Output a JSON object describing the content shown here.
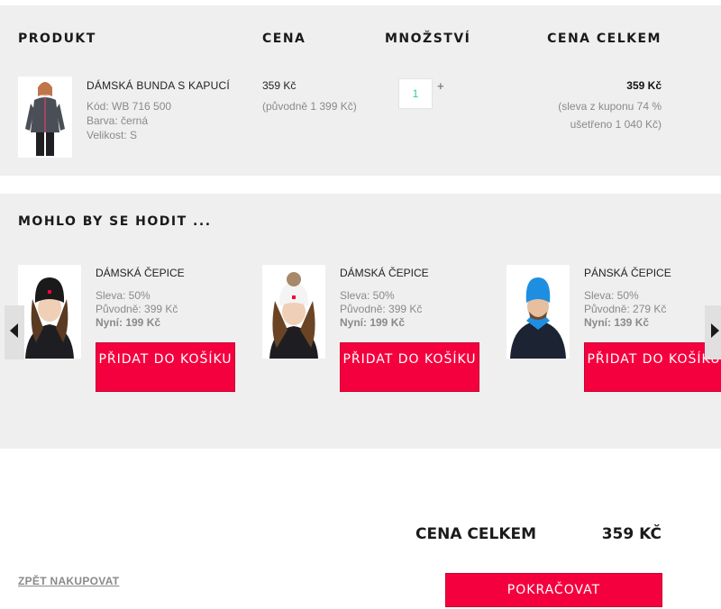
{
  "cart": {
    "headers": {
      "product": "PRODUKT",
      "price": "CENA",
      "quantity": "MNOŽSTVÍ",
      "total": "CENA CELKEM"
    },
    "item": {
      "name": "DÁMSKÁ BUNDA S KAPUCÍ",
      "code": "Kód: WB 716 500",
      "color": "Barva: černá",
      "size": "Velikost: S",
      "price_now": "359 Kč",
      "price_original": "(původně 1 399 Kč)",
      "quantity": "1",
      "quantity_plus": "+",
      "total": "359 Kč",
      "total_note": "(sleva z kuponu 74 % ušetřeno 1 040 Kč)"
    }
  },
  "recommendations": {
    "title": "MOHLO BY SE HODIT ...",
    "items": [
      {
        "name": "DÁMSKÁ ČEPICE",
        "discount": "Sleva: 50%",
        "original": "Původně: 399 Kč",
        "now": "Nyní: 199 Kč",
        "button": "PŘIDAT DO KOŠÍKU",
        "hat_color": "#1a1a1a"
      },
      {
        "name": "DÁMSKÁ ČEPICE",
        "discount": "Sleva: 50%",
        "original": "Původně: 399 Kč",
        "now": "Nyní: 199 Kč",
        "button": "PŘIDAT DO KOŠÍKU",
        "hat_color": "#f4f4f4"
      },
      {
        "name": "PÁNSKÁ ČEPICE",
        "discount": "Sleva: 50%",
        "original": "Původně: 279 Kč",
        "now": "Nyní: 139 Kč",
        "button": "PŘIDAT DO KOŠÍKU",
        "hat_color": "#1e8fe0"
      }
    ],
    "prev_icon": "triangle-left-icon",
    "next_icon": "triangle-right-icon"
  },
  "summary": {
    "label": "CENA CELKEM",
    "value": "359 KČ",
    "back_link": "ZPĚT NAKUPOVAT",
    "continue_button": "POKRAČOVAT"
  },
  "colors": {
    "accent": "#f5003e",
    "panel": "#efefef"
  }
}
